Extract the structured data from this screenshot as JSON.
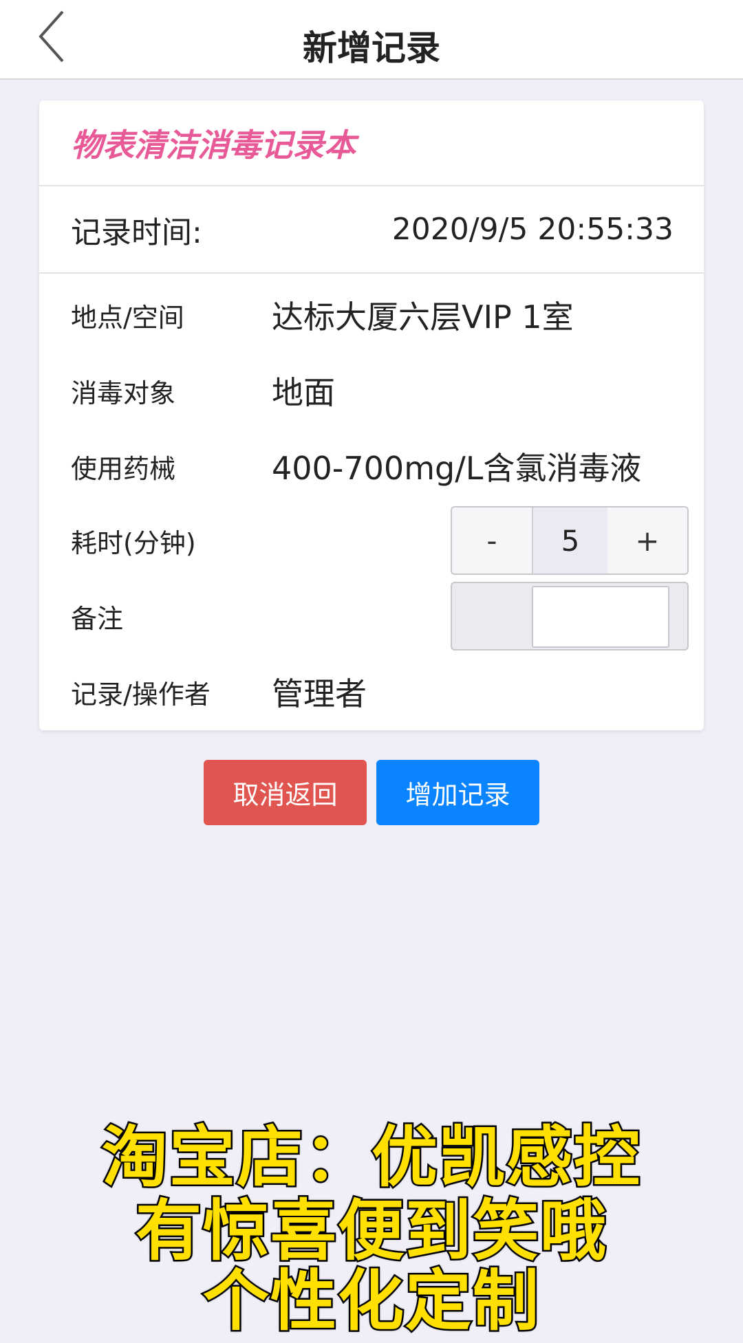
{
  "nav": {
    "title": "新增记录"
  },
  "card": {
    "title": "物表清洁消毒记录本",
    "time_label": "记录时间:",
    "time_value": "2020/9/5 20:55:33",
    "fields": {
      "location_label": "地点/空间",
      "location_value": "达标大厦六层VIP 1室",
      "target_label": "消毒对象",
      "target_value": "地面",
      "agent_label": "使用药械",
      "agent_value": "400-700mg/L含氯消毒液",
      "duration_label": "耗时(分钟)",
      "duration_value": "5",
      "minus": "-",
      "plus": "+",
      "note_label": "备注",
      "note_value": "",
      "operator_label": "记录/操作者",
      "operator_value": "管理者"
    }
  },
  "buttons": {
    "cancel": "取消返回",
    "add": "增加记录"
  },
  "caption": {
    "line1": "淘宝店：优凯感控",
    "line2": "有惊喜便到笑哦",
    "line3": "个性化定制"
  },
  "colors": {
    "accent_pink": "#e85a97",
    "cancel_red": "#e05550",
    "add_blue": "#0a84ff",
    "caption_yellow": "#ffe000"
  }
}
